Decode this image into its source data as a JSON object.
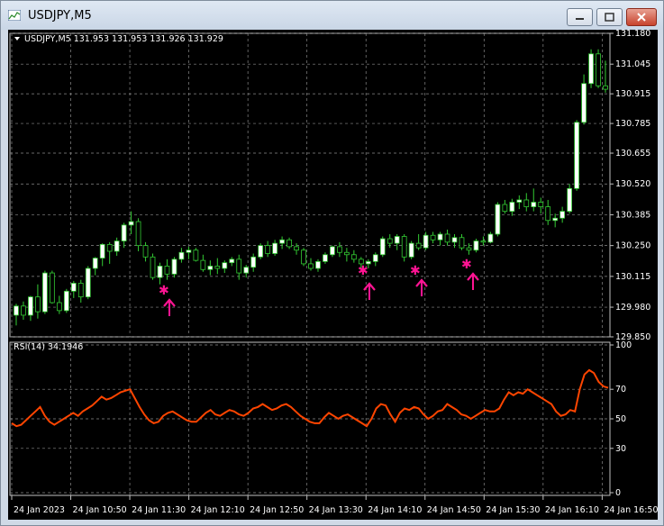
{
  "window": {
    "title": "USDJPY,M5"
  },
  "header": {
    "label": "USDJPY,M5  131.953 131.953 131.926 131.929"
  },
  "rsi": {
    "label": "RSI(14) 34.1946",
    "levels": [
      100,
      70,
      50,
      30,
      0
    ]
  },
  "colors": {
    "background": "#000000",
    "bull": "#ffffff",
    "bear": "#000000",
    "wick": "#33cc33",
    "rsi": "#ff4500",
    "arrow": "#ff1493",
    "grid": "#8a8a8a"
  },
  "chart_data": {
    "type": "candlestick",
    "price_ticks": [
      "131.180",
      "131.045",
      "130.915",
      "130.785",
      "130.655",
      "130.520",
      "130.385",
      "130.250",
      "130.115",
      "129.980",
      "129.850"
    ],
    "time_labels": [
      "24 Jan 2023",
      "24 Jan 10:50",
      "24 Jan 11:30",
      "24 Jan 12:10",
      "24 Jan 12:50",
      "24 Jan 13:30",
      "24 Jan 14:10",
      "24 Jan 14:50",
      "24 Jan 15:30",
      "24 Jan 16:10",
      "24 Jan 16:50"
    ],
    "ylim": [
      129.85,
      131.18
    ],
    "rsi_ylim": [
      0,
      100
    ],
    "candles": [
      [
        129.945,
        129.995,
        129.9,
        129.985
      ],
      [
        129.985,
        130.005,
        129.925,
        129.945
      ],
      [
        129.945,
        130.03,
        129.92,
        130.025
      ],
      [
        130.025,
        130.08,
        129.93,
        129.96
      ],
      [
        129.96,
        130.14,
        129.95,
        130.13
      ],
      [
        130.13,
        130.14,
        129.995,
        130.0
      ],
      [
        130.0,
        130.03,
        129.95,
        129.965
      ],
      [
        129.965,
        130.06,
        129.955,
        130.05
      ],
      [
        130.05,
        130.095,
        130.02,
        130.085
      ],
      [
        130.085,
        130.1,
        130.0,
        130.025
      ],
      [
        130.025,
        130.16,
        130.015,
        130.15
      ],
      [
        130.15,
        130.2,
        130.12,
        130.195
      ],
      [
        130.195,
        130.26,
        130.16,
        130.255
      ],
      [
        130.255,
        130.265,
        130.17,
        130.225
      ],
      [
        130.225,
        130.285,
        130.205,
        130.27
      ],
      [
        130.27,
        130.35,
        130.24,
        130.34
      ],
      [
        130.34,
        130.4,
        130.3,
        130.355
      ],
      [
        130.355,
        130.37,
        130.225,
        130.25
      ],
      [
        130.25,
        130.265,
        130.18,
        130.2
      ],
      [
        130.2,
        130.215,
        130.1,
        130.11
      ],
      [
        130.11,
        130.175,
        130.08,
        130.16
      ],
      [
        130.16,
        130.19,
        130.1,
        130.125
      ],
      [
        130.125,
        130.2,
        130.11,
        130.19
      ],
      [
        130.19,
        130.24,
        130.175,
        130.22
      ],
      [
        130.22,
        130.245,
        130.19,
        130.23
      ],
      [
        130.23,
        130.24,
        130.18,
        130.185
      ],
      [
        130.185,
        130.21,
        130.135,
        130.145
      ],
      [
        130.145,
        130.185,
        130.12,
        130.16
      ],
      [
        130.16,
        130.195,
        130.125,
        130.15
      ],
      [
        130.15,
        130.185,
        130.13,
        130.175
      ],
      [
        130.175,
        130.2,
        130.16,
        130.19
      ],
      [
        130.19,
        130.21,
        130.1,
        130.13
      ],
      [
        130.13,
        130.165,
        130.11,
        130.155
      ],
      [
        130.155,
        130.215,
        130.135,
        130.2
      ],
      [
        130.2,
        130.26,
        130.19,
        130.25
      ],
      [
        130.25,
        130.27,
        130.2,
        130.215
      ],
      [
        130.215,
        130.275,
        130.205,
        130.26
      ],
      [
        130.26,
        130.29,
        130.235,
        130.275
      ],
      [
        130.275,
        130.285,
        130.235,
        130.245
      ],
      [
        130.245,
        130.26,
        130.21,
        130.23
      ],
      [
        130.23,
        130.24,
        130.16,
        130.17
      ],
      [
        130.17,
        130.195,
        130.14,
        130.15
      ],
      [
        130.15,
        130.19,
        130.135,
        130.18
      ],
      [
        130.18,
        130.22,
        130.17,
        130.21
      ],
      [
        130.21,
        130.25,
        130.2,
        130.245
      ],
      [
        130.245,
        130.265,
        130.2,
        130.22
      ],
      [
        130.22,
        130.24,
        130.18,
        130.21
      ],
      [
        130.21,
        130.23,
        130.175,
        130.19
      ],
      [
        130.19,
        130.2,
        130.15,
        130.17
      ],
      [
        130.17,
        130.19,
        130.15,
        130.18
      ],
      [
        130.18,
        130.22,
        130.16,
        130.21
      ],
      [
        130.21,
        130.29,
        130.2,
        130.28
      ],
      [
        130.28,
        130.3,
        130.24,
        130.26
      ],
      [
        130.26,
        130.3,
        130.23,
        130.29
      ],
      [
        130.29,
        130.3,
        130.18,
        130.2
      ],
      [
        130.2,
        130.27,
        130.19,
        130.26
      ],
      [
        130.26,
        130.3,
        130.23,
        130.24
      ],
      [
        130.24,
        130.31,
        130.23,
        130.295
      ],
      [
        130.295,
        130.31,
        130.26,
        130.275
      ],
      [
        130.275,
        130.31,
        130.25,
        130.3
      ],
      [
        130.3,
        130.32,
        130.25,
        130.265
      ],
      [
        130.265,
        130.3,
        130.24,
        130.285
      ],
      [
        130.285,
        130.3,
        130.23,
        130.24
      ],
      [
        130.24,
        130.26,
        130.21,
        130.23
      ],
      [
        130.23,
        130.28,
        130.22,
        130.27
      ],
      [
        130.27,
        130.29,
        130.25,
        130.265
      ],
      [
        130.265,
        130.31,
        130.26,
        130.3
      ],
      [
        130.3,
        130.44,
        130.29,
        130.43
      ],
      [
        130.43,
        130.45,
        130.39,
        130.4
      ],
      [
        130.4,
        130.455,
        130.38,
        130.44
      ],
      [
        130.44,
        130.47,
        130.41,
        130.45
      ],
      [
        130.45,
        130.48,
        130.4,
        130.42
      ],
      [
        130.42,
        130.5,
        130.4,
        130.44
      ],
      [
        130.44,
        130.46,
        130.39,
        130.42
      ],
      [
        130.42,
        130.45,
        130.34,
        130.36
      ],
      [
        130.36,
        130.39,
        130.33,
        130.37
      ],
      [
        130.37,
        130.42,
        130.35,
        130.4
      ],
      [
        130.4,
        130.52,
        130.39,
        130.5
      ],
      [
        130.5,
        130.8,
        130.49,
        130.79
      ],
      [
        130.79,
        131.0,
        130.78,
        130.96
      ],
      [
        130.96,
        131.11,
        130.94,
        131.09
      ],
      [
        131.09,
        131.11,
        130.94,
        130.95
      ],
      [
        130.95,
        131.06,
        130.92,
        130.935
      ]
    ],
    "rsi": [
      47,
      45,
      46,
      49,
      52,
      55,
      58,
      52,
      48,
      46,
      48,
      50,
      52,
      54,
      52,
      55,
      57,
      59,
      62,
      65,
      63,
      64,
      66,
      68,
      69,
      70,
      64,
      58,
      53,
      49,
      47,
      48,
      52,
      54,
      55,
      53,
      51,
      49,
      48,
      48,
      51,
      54,
      56,
      53,
      52,
      54,
      56,
      55,
      53,
      52,
      54,
      57,
      58,
      60,
      58,
      56,
      57,
      59,
      60,
      58,
      55,
      52,
      50,
      48,
      47,
      47,
      51,
      54,
      52,
      50,
      52,
      53,
      51,
      49,
      47,
      45,
      50,
      57,
      60,
      59,
      53,
      48,
      54,
      57,
      56,
      58,
      57,
      53,
      50,
      52,
      55,
      56,
      60,
      58,
      56,
      53,
      52,
      50,
      52,
      54,
      56,
      55,
      55,
      57,
      63,
      68,
      66,
      68,
      67,
      70,
      68,
      66,
      64,
      62,
      60,
      55,
      52,
      53,
      56,
      55,
      70,
      80,
      83,
      81,
      75,
      72,
      71
    ]
  }
}
